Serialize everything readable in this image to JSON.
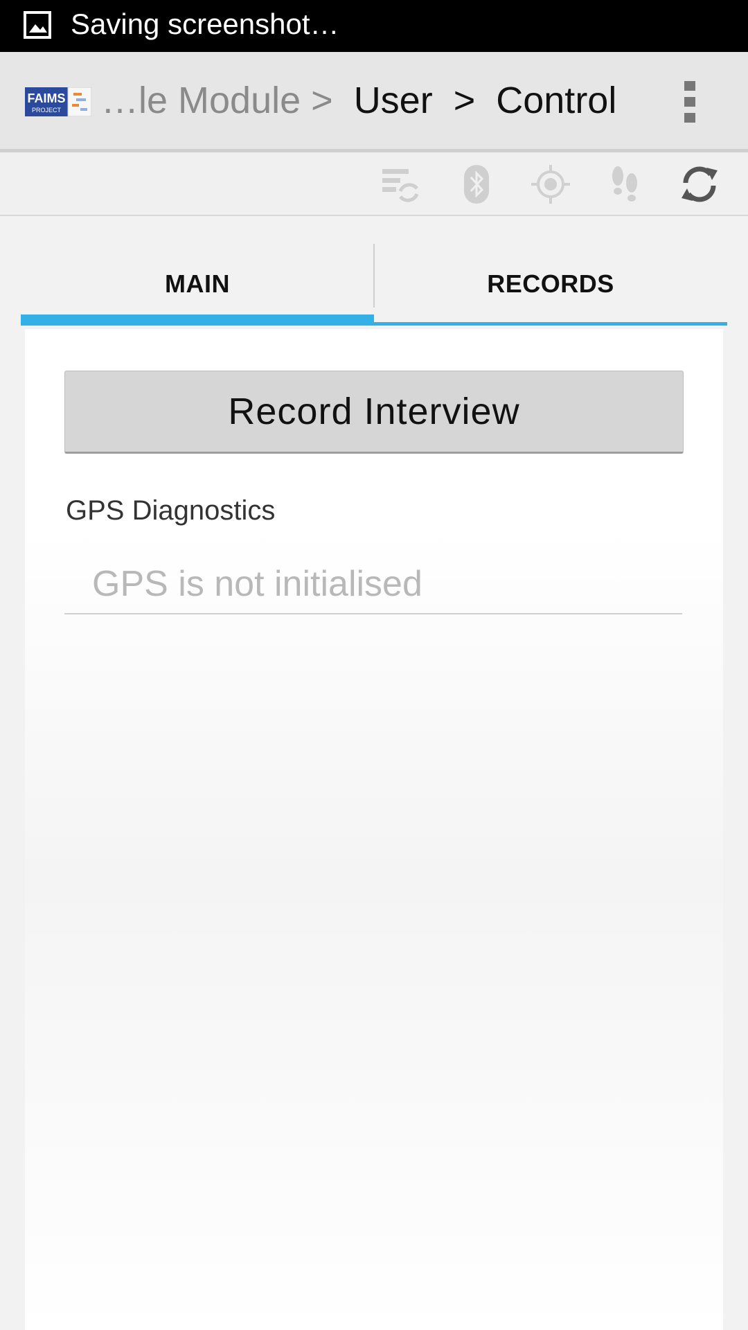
{
  "status_bar": {
    "text": "Saving screenshot…",
    "icon": "image-icon"
  },
  "action_bar": {
    "logo_text": "FAIMS",
    "logo_subtext": "PROJECT",
    "breadcrumb_muted": "…le Module >",
    "breadcrumb_1": "User",
    "separator": ">",
    "breadcrumb_2": "Control",
    "overflow_icon": "more-vertical-icon"
  },
  "toolbar": {
    "icons": [
      "sync-list-icon",
      "bluetooth-icon",
      "gps-target-icon",
      "footsteps-icon",
      "refresh-icon"
    ]
  },
  "tabs": [
    {
      "label": "MAIN",
      "selected": true
    },
    {
      "label": "RECORDS",
      "selected": false
    }
  ],
  "main": {
    "record_button": "Record Interview",
    "gps_label": "GPS Diagnostics",
    "gps_placeholder": "GPS is not initialised"
  },
  "colors": {
    "accent": "#33b0e6",
    "status_bar": "#000000",
    "action_bar": "#e6e6e6"
  }
}
